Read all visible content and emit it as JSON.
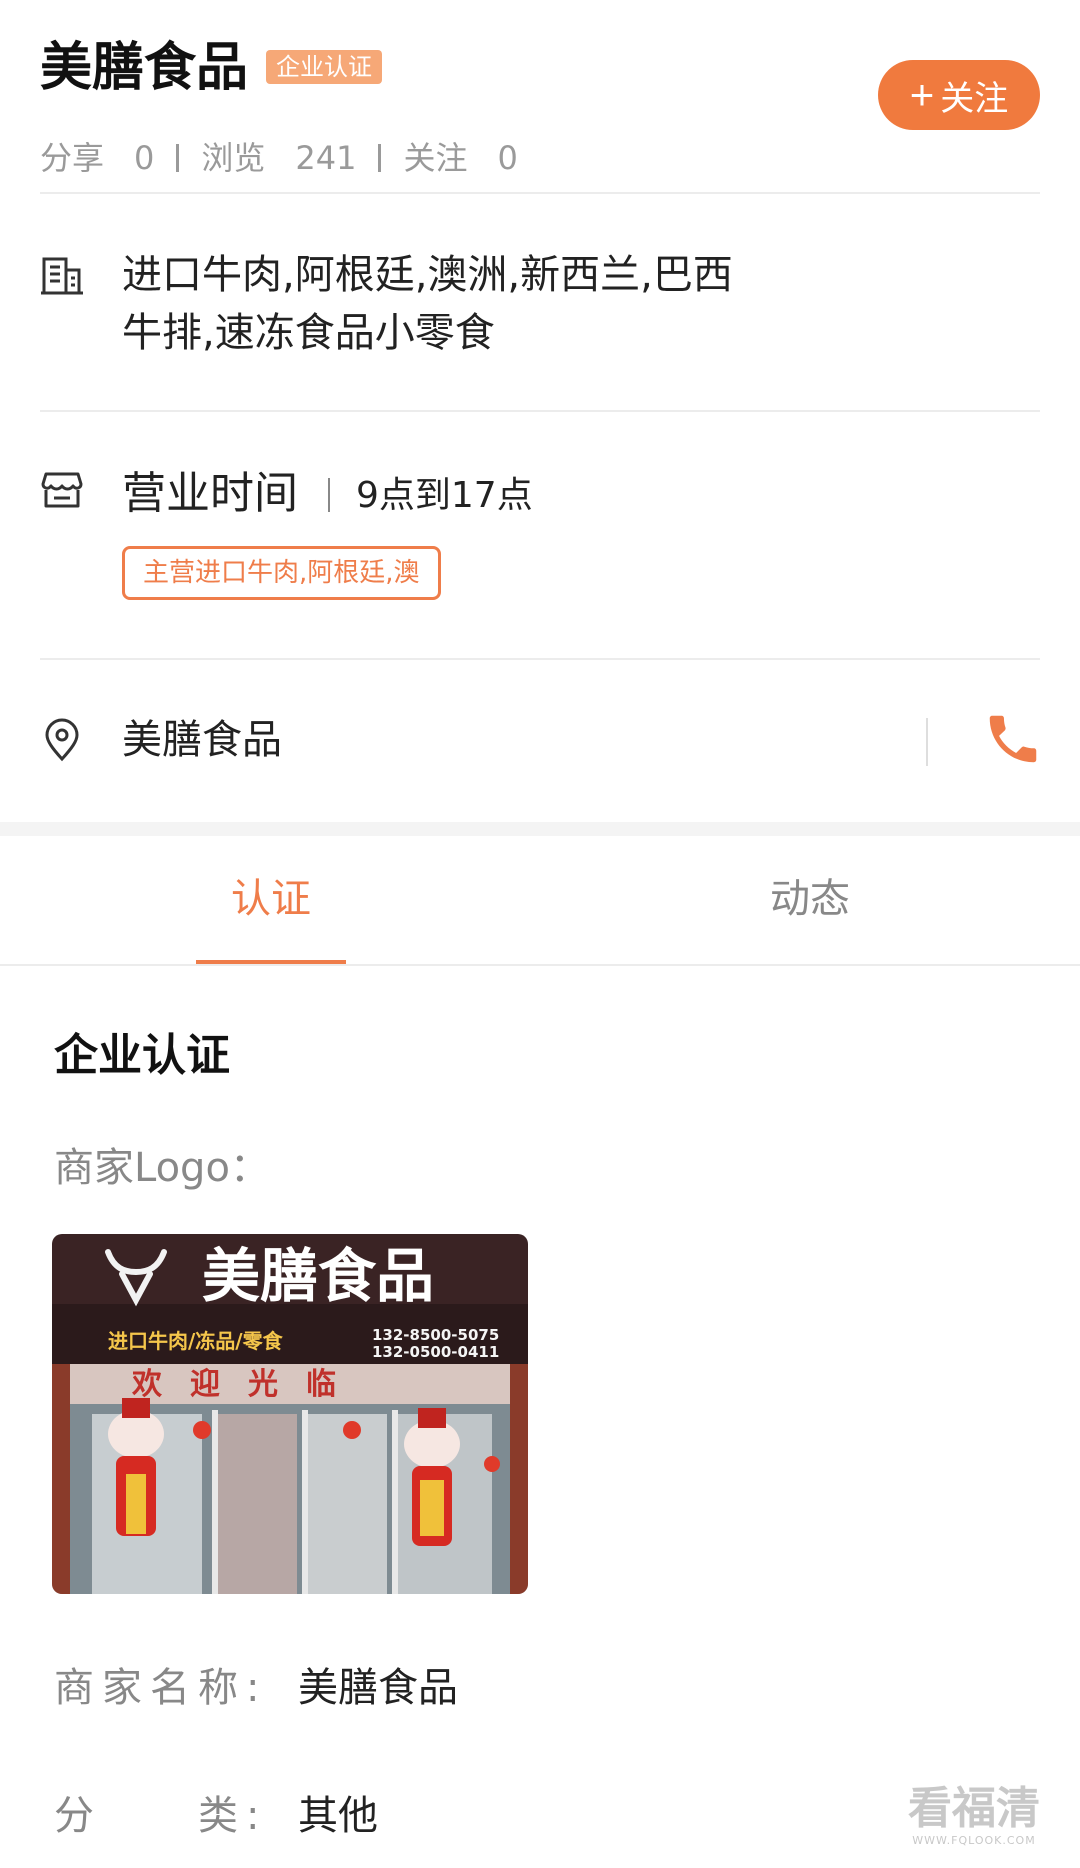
{
  "shop": {
    "title": "美膳食品",
    "badge": "企业认证",
    "follow_label": "关注",
    "stats": [
      {
        "label": "分享",
        "value": "0"
      },
      {
        "label": "浏览",
        "value": "241"
      },
      {
        "label": "关注",
        "value": "0"
      }
    ]
  },
  "info": {
    "description_line1": "进口牛肉,阿根廷,澳洲,新西兰,巴西",
    "description_line2": "牛排,速冻食品小零食",
    "hours_label": "营业时间",
    "hours_value": "9点到17点",
    "main_tag": "主营进口牛肉,阿根廷,澳",
    "address": "美膳食品"
  },
  "tabs": [
    {
      "label": "认证",
      "active": true
    },
    {
      "label": "动态",
      "active": false
    }
  ],
  "cert": {
    "section_title": "企业认证",
    "logo_label": "商家Logo：",
    "logo_sign": {
      "brand": "美膳食品",
      "slogan": "进口牛肉/冻品/零食",
      "phone1": "132-8500-5075",
      "phone2": "132-0500-0411",
      "welcome": "欢迎光临"
    },
    "name_key": "商家名称:",
    "name_value": "美膳食品",
    "category_key": "分　　类:",
    "category_value": "其他"
  },
  "watermark": {
    "main": "看福清",
    "sub": "WWW.FQLOOK.COM"
  },
  "colors": {
    "accent": "#ef7d4a",
    "follow": "#f07a3e",
    "badge": "#f6a877",
    "muted": "#888888"
  },
  "icons": [
    "building-icon",
    "shop-icon",
    "location-pin-icon",
    "phone-icon",
    "plus-icon",
    "bull-logo-icon"
  ]
}
